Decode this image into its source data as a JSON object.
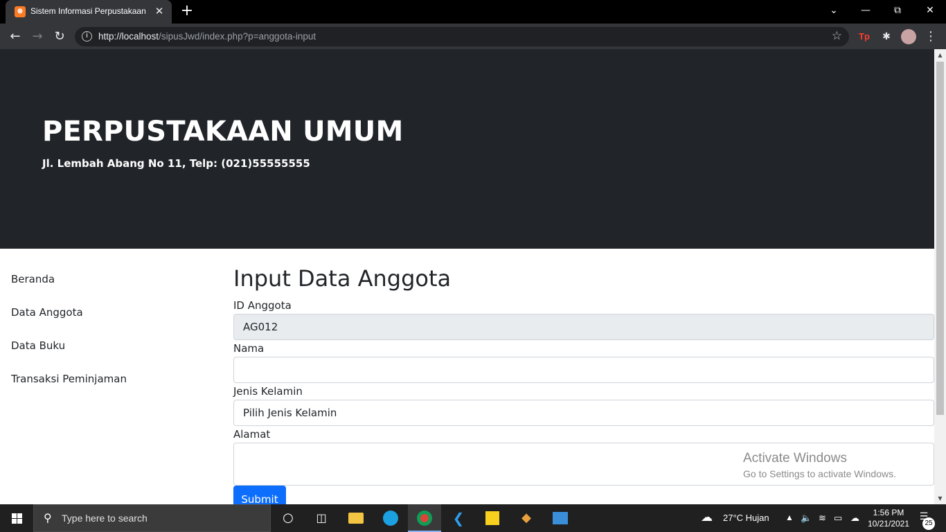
{
  "browser": {
    "tab_title": "Sistem Informasi Perpustakaan",
    "tab_favicon_text": "⊙",
    "url_host": "http://localhost",
    "url_path": "/sipusJwd/index.php?p=anggota-input"
  },
  "header": {
    "title": "PERPUSTAKAAN UMUM",
    "subtitle": "Jl. Lembah Abang No 11, Telp: (021)55555555"
  },
  "sidebar": {
    "items": [
      {
        "label": "Beranda"
      },
      {
        "label": "Data Anggota"
      },
      {
        "label": "Data Buku"
      },
      {
        "label": "Transaksi Peminjaman"
      }
    ]
  },
  "form": {
    "title": "Input Data Anggota",
    "id_label": "ID Anggota",
    "id_value": "AG012",
    "nama_label": "Nama",
    "nama_value": "",
    "jk_label": "Jenis Kelamin",
    "jk_selected": "Pilih Jenis Kelamin",
    "alamat_label": "Alamat",
    "alamat_value": "",
    "submit_label": "Submit"
  },
  "watermark": {
    "line1": "Activate Windows",
    "line2": "Go to Settings to activate Windows."
  },
  "taskbar": {
    "search_placeholder": "Type here to search",
    "weather": "27°C  Hujan",
    "time": "1:56 PM",
    "date": "10/21/2021",
    "notification_count": "25"
  }
}
